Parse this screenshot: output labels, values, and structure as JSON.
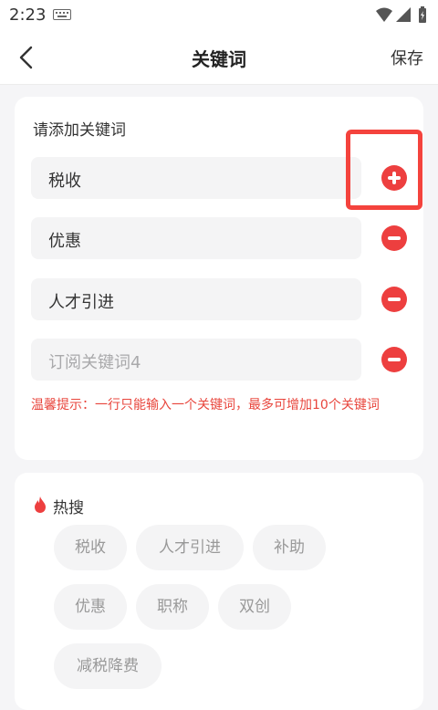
{
  "status": {
    "time": "2:23"
  },
  "nav": {
    "title": "关键词",
    "save_label": "保存"
  },
  "keywords": {
    "section_title": "请添加关键词",
    "items": [
      {
        "value": "税收",
        "action": "add"
      },
      {
        "value": "优惠",
        "action": "remove"
      },
      {
        "value": "人才引进",
        "action": "remove"
      }
    ],
    "empty_field": {
      "placeholder": "订阅关键词4",
      "action": "remove"
    },
    "tip": "温馨提示：一行只能输入一个关键词，最多可增加10个关键词"
  },
  "hot": {
    "title": "热搜",
    "tags": [
      "税收",
      "人才引进",
      "补助",
      "优惠",
      "职称",
      "双创",
      "减税降费"
    ]
  },
  "colors": {
    "accent": "#ed3f3f",
    "highlight": "#f4433d"
  }
}
